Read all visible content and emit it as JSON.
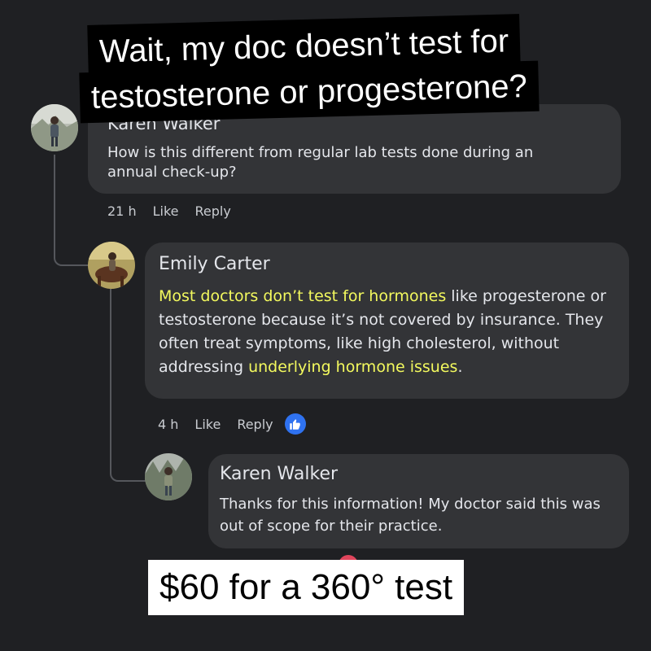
{
  "headline": {
    "line1": "Wait, my doc doesn’t test for",
    "line2": "testosterone or progesterone?"
  },
  "comment1": {
    "author": "Karen Walker",
    "text": "How is this different from regular lab tests done during an annual check-up?",
    "time": "21 h",
    "like_label": "Like",
    "reply_label": "Reply"
  },
  "comment2": {
    "author": "Emily Carter",
    "text_hl1": "Most doctors don’t test for hormones",
    "text_mid": " like progesterone or testosterone because it’s not covered by insurance. They often treat symptoms, like high cholesterol, without addressing ",
    "text_hl2": "underlying hormone issues",
    "text_end": ".",
    "time": "4 h",
    "like_label": "Like",
    "reply_label": "Reply",
    "reaction_icon": "thumbs-up-icon"
  },
  "comment3": {
    "author": "Karen Walker",
    "text": "Thanks for this information! My doctor said this was out of scope for their practice."
  },
  "bottom_caption": "$60 for a 360° test",
  "colors": {
    "background": "#1f2023",
    "bubble": "#333437",
    "highlight": "#f3f95e",
    "like_blue": "#2f72f0"
  }
}
